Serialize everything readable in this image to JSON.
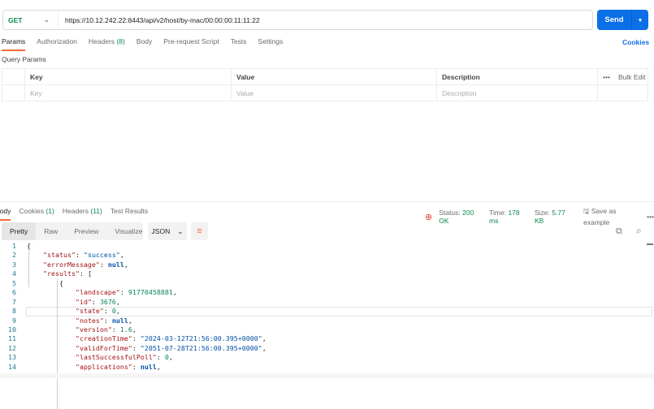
{
  "request": {
    "method": "GET",
    "url": "https://10.12.242.22:8443/api/v2/host/by-mac/00:00:00:11:11:22",
    "send_label": "Send"
  },
  "req_tabs": [
    {
      "label": "Params"
    },
    {
      "label": "Authorization"
    },
    {
      "label": "Headers",
      "count": "(8)"
    },
    {
      "label": "Body"
    },
    {
      "label": "Pre-request Script"
    },
    {
      "label": "Tests"
    },
    {
      "label": "Settings"
    }
  ],
  "cookies_link": "Cookies",
  "query_params": {
    "title": "Query Params",
    "headers": [
      "Key",
      "Value",
      "Description"
    ],
    "bulk_edit": "Bulk Edit",
    "more": "•••",
    "placeholders": [
      "Key",
      "Value",
      "Description"
    ]
  },
  "res_tabs": [
    {
      "label": "Body"
    },
    {
      "label": "Cookies",
      "count": "(1)"
    },
    {
      "label": "Headers",
      "count": "(11)"
    },
    {
      "label": "Test Results"
    }
  ],
  "response_meta": {
    "status_label": "Status:",
    "status": "200 OK",
    "time_label": "Time:",
    "time": "178 ms",
    "size_label": "Size:",
    "size": "5.77 KB",
    "save": "Save as example",
    "more": "•••"
  },
  "view_modes": [
    "Pretty",
    "Raw",
    "Preview",
    "Visualize"
  ],
  "format": "JSON",
  "code_lines": [
    [
      [
        "p",
        "{"
      ]
    ],
    [
      [
        "k",
        "\"status\""
      ],
      [
        "p",
        ": "
      ],
      [
        "s",
        "\"success\""
      ],
      [
        "p",
        ","
      ]
    ],
    [
      [
        "k",
        "\"errorMessage\""
      ],
      [
        "p",
        ": "
      ],
      [
        "nl",
        "null"
      ],
      [
        "p",
        ","
      ]
    ],
    [
      [
        "k",
        "\"results\""
      ],
      [
        "p",
        ": ["
      ]
    ],
    [
      [
        "p",
        "{"
      ]
    ],
    [
      [
        "k",
        "\"landscape\""
      ],
      [
        "p",
        ": "
      ],
      [
        "n",
        "91770458881"
      ],
      [
        "p",
        ","
      ]
    ],
    [
      [
        "k",
        "\"id\""
      ],
      [
        "p",
        ": "
      ],
      [
        "n",
        "3676"
      ],
      [
        "p",
        ","
      ]
    ],
    [
      [
        "k",
        "\"state\""
      ],
      [
        "p",
        ": "
      ],
      [
        "n",
        "0"
      ],
      [
        "p",
        ","
      ]
    ],
    [
      [
        "k",
        "\"notes\""
      ],
      [
        "p",
        ": "
      ],
      [
        "nl",
        "null"
      ],
      [
        "p",
        ","
      ]
    ],
    [
      [
        "k",
        "\"version\""
      ],
      [
        "p",
        ": "
      ],
      [
        "n",
        "1.6"
      ],
      [
        "p",
        ","
      ]
    ],
    [
      [
        "k",
        "\"creationTime\""
      ],
      [
        "p",
        ": "
      ],
      [
        "s",
        "\"2024-03-12T21:56:00.395+0000\""
      ],
      [
        "p",
        ","
      ]
    ],
    [
      [
        "k",
        "\"validForTime\""
      ],
      [
        "p",
        ": "
      ],
      [
        "s",
        "\"2051-07-28T21:56:00.395+0000\""
      ],
      [
        "p",
        ","
      ]
    ],
    [
      [
        "k",
        "\"lastSuccessfulPoll\""
      ],
      [
        "p",
        ": "
      ],
      [
        "n",
        "0"
      ],
      [
        "p",
        ","
      ]
    ],
    [
      [
        "k",
        "\"applications\""
      ],
      [
        "p",
        ": "
      ],
      [
        "nl",
        "null"
      ],
      [
        "p",
        ","
      ]
    ]
  ],
  "indents": [
    0,
    1,
    1,
    1,
    2,
    3,
    3,
    3,
    3,
    3,
    3,
    3,
    3,
    3
  ]
}
